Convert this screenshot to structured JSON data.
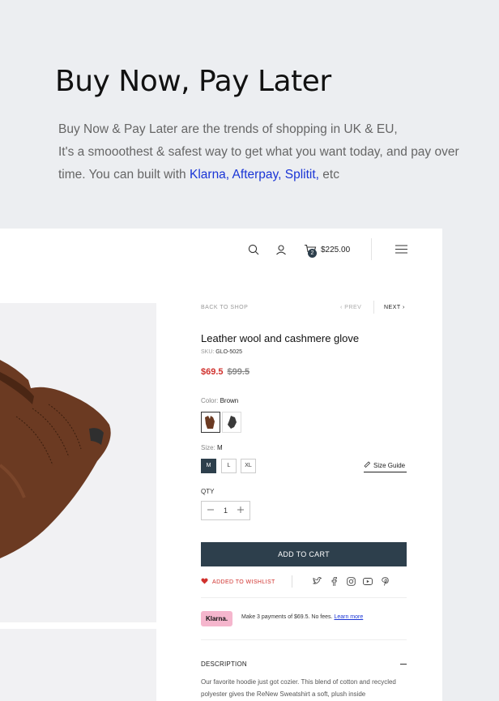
{
  "hero": {
    "title": "Buy Now, Pay Later",
    "line1": "Buy Now & Pay Later are the trends of shopping in UK & EU,",
    "line2": "It's a smooothest & safest way to get what you want today, and pay over",
    "line3_start": "time. You can built with ",
    "providers": "Klarna, Afterpay, Splitit,",
    "line3_end": " etc"
  },
  "header": {
    "icons": [
      "search-icon",
      "user-icon",
      "cart-icon",
      "menu-icon"
    ],
    "cart_count": "2",
    "cart_total": "$225.00"
  },
  "product": {
    "breadcrumb": "BACK TO SHOP",
    "prev": "PREV",
    "next": "NEXT",
    "title": "Leather wool and cashmere glove",
    "sku_label": "SKU:",
    "sku_value": "GLO-5025",
    "price_sale": "$69.5",
    "price_old": "$99.5",
    "color_label": "Color:",
    "color_value": "Brown",
    "size_label": "Size:",
    "size_value": "M",
    "sizes": [
      "M",
      "L",
      "XL"
    ],
    "size_guide": "Size Guide",
    "qty_label": "QTY",
    "qty_value": "1",
    "add_to_cart": "ADD TO CART",
    "wishlist": "ADDED TO WISHLIST",
    "social_icons": [
      "twitter-icon",
      "facebook-icon",
      "instagram-icon",
      "youtube-icon",
      "pinterest-icon"
    ],
    "klarna_badge": "Klarna.",
    "klarna_text": "Make 3 payments of $69.5. No fees.",
    "klarna_link": "Learn more",
    "description_title": "DESCRIPTION",
    "description_text": "Our favorite hoodie just got cozier. This blend of cotton and recycled polyester gives the ReNew Sweatshirt a soft, plush inside"
  },
  "colors": {
    "accent": "#2d3f4c",
    "sale": "#d0312d",
    "link": "#1a35d6",
    "klarna": "#f5b6cd"
  }
}
